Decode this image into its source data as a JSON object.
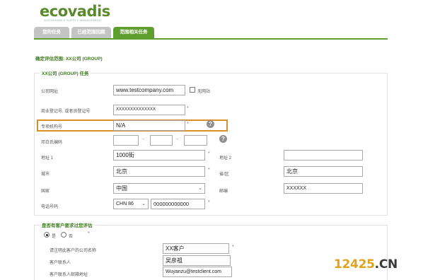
{
  "logo": {
    "text": "ecovadis",
    "tagline": "SUSTAINABLE SUPPLY MANAGEMENT"
  },
  "tabs": [
    {
      "label": "您的任务",
      "active": false
    },
    {
      "label": "已经范围回顾",
      "active": false
    },
    {
      "label": "范围相关任务",
      "active": true
    }
  ],
  "scope_title": "确定评估范围: XX公司 (GROUP)",
  "company_section": {
    "legend": "XX公司 (GROUP) 任务",
    "website_label": "公司网址",
    "website_value": "www.testcompany.com",
    "no_website_label": "无网站",
    "reg_label": "商业登记号, 或者员登记号",
    "reg_value": "XXXXXXXXXXXXXX",
    "tax_label": "专项机构号",
    "tax_value": "N/A",
    "duns_label": "邓白氏编码",
    "addr1_label": "地址 1",
    "addr1_value": "1000街",
    "addr2_label": "地址 2",
    "addr2_value": "",
    "city_label": "城市",
    "city_value": "北京",
    "province_label": "省/区",
    "province_value": "北京",
    "country_label": "国家",
    "country_value": "中国",
    "postal_label": "邮编",
    "postal_value": "XXXXXX",
    "phone_label": "电话号码",
    "phone_code": "CHN 86",
    "phone_value": "000000000000",
    "required_mark": "*",
    "help_glyph": "?"
  },
  "client_section": {
    "legend": "是否有客户要求过您评估",
    "yes_label": "是",
    "no_label": "否",
    "yes_selected": true,
    "client_company_label": "请注明此客户的公司名称",
    "client_company_value": "XX客户",
    "contact_label": "客户联系人",
    "contact_value": "吴彦祖",
    "email_label": "客户联系人邮箱地址",
    "email_value": "Wuyanzu@testclient.com"
  },
  "watermark": {
    "part1": "12425",
    "part2": ".CN"
  },
  "colors": {
    "brand_green": "#5e9e2e",
    "highlight_orange": "#d9902a"
  }
}
